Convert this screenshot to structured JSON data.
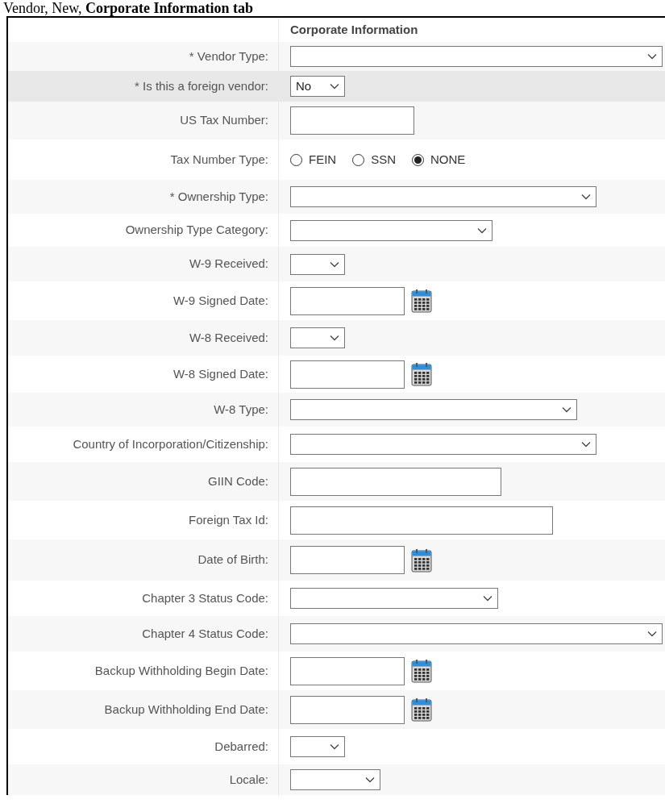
{
  "caption": "Vendor, New, **Corporate Information tab**",
  "section_title": "Corporate Information",
  "rows": [
    {
      "label": "* Vendor Type:",
      "kind": "select",
      "highlighted": false
    },
    {
      "label": "* Is this a foreign vendor:",
      "kind": "select",
      "value": "No",
      "highlighted": true
    },
    {
      "label": "US Tax Number:",
      "kind": "text",
      "highlighted": false
    },
    {
      "label": "Tax Number Type:",
      "kind": "radio",
      "highlighted": false,
      "options": [
        {
          "label": "FEIN",
          "selected": false
        },
        {
          "label": "SSN",
          "selected": false
        },
        {
          "label": "NONE",
          "selected": true
        }
      ]
    },
    {
      "label": "* Ownership Type:",
      "kind": "select",
      "highlighted": false
    },
    {
      "label": "Ownership Type Category:",
      "kind": "select",
      "highlighted": false
    },
    {
      "label": "W-9 Received:",
      "kind": "select",
      "highlighted": false
    },
    {
      "label": "W-9 Signed Date:",
      "kind": "date",
      "highlighted": false
    },
    {
      "label": "W-8 Received:",
      "kind": "select",
      "highlighted": false
    },
    {
      "label": "W-8 Signed Date:",
      "kind": "date",
      "highlighted": false
    },
    {
      "label": "W-8 Type:",
      "kind": "select",
      "highlighted": false
    },
    {
      "label": "Country of Incorporation/Citizenship:",
      "kind": "select",
      "highlighted": false
    },
    {
      "label": "GIIN Code:",
      "kind": "text",
      "highlighted": false
    },
    {
      "label": "Foreign Tax Id:",
      "kind": "text",
      "highlighted": false
    },
    {
      "label": "Date of Birth:",
      "kind": "date",
      "highlighted": false
    },
    {
      "label": "Chapter 3 Status Code:",
      "kind": "select",
      "highlighted": false
    },
    {
      "label": "Chapter 4 Status Code:",
      "kind": "select",
      "highlighted": false
    },
    {
      "label": "Backup Withholding Begin Date:",
      "kind": "date",
      "highlighted": false
    },
    {
      "label": "Backup Withholding End Date:",
      "kind": "date",
      "highlighted": false
    },
    {
      "label": "Debarred:",
      "kind": "select",
      "highlighted": false
    },
    {
      "label": "Locale:",
      "kind": "select",
      "highlighted": false
    }
  ]
}
